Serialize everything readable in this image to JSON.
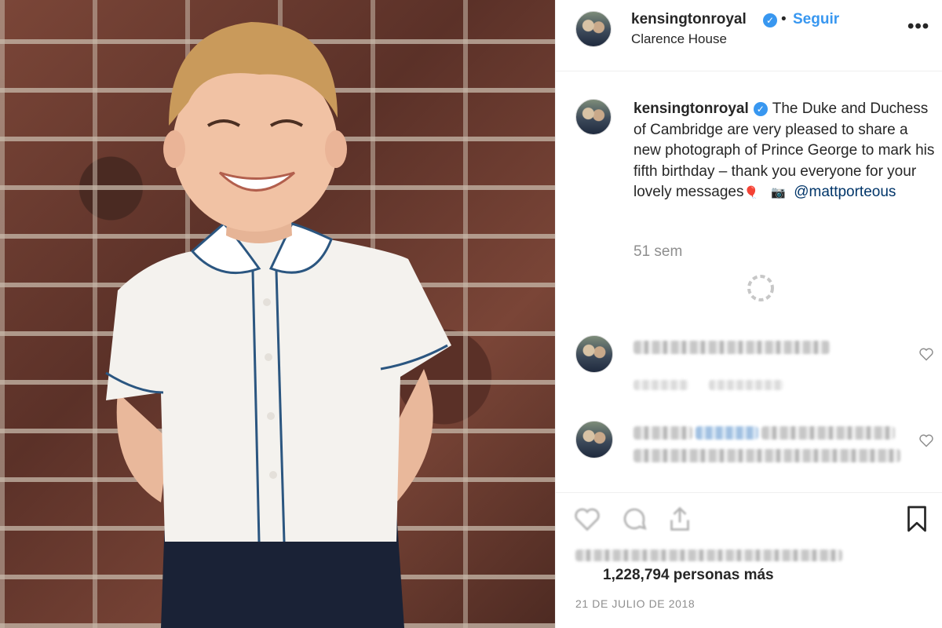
{
  "post": {
    "username": "kensingtonroyal",
    "verified_icon": "verified-check-icon",
    "separator": "•",
    "follow_label": "Seguir",
    "location": "Clarence House",
    "more_label": "•••"
  },
  "caption": {
    "username": "kensingtonroyal",
    "text": "The Duke and Duchess of Cambridge are very pleased to share a new photograph of Prince George to mark his fifth birthday – thank you everyone for your lovely messages",
    "emoji_balloon": "🎈",
    "emoji_camera": "📷",
    "mention": "@mattporteous",
    "time_ago": "51 sem"
  },
  "actions": {
    "like_icon": "heart-icon",
    "comment_icon": "comment-icon",
    "share_icon": "share-icon",
    "save_icon": "bookmark-icon"
  },
  "likes": {
    "others_text": "1,228,794 personas más"
  },
  "date": "21 DE JULIO DE 2018",
  "colors": {
    "accent": "#3897f0",
    "mention": "#003569",
    "text": "#262626",
    "muted": "#8e8e8e"
  }
}
